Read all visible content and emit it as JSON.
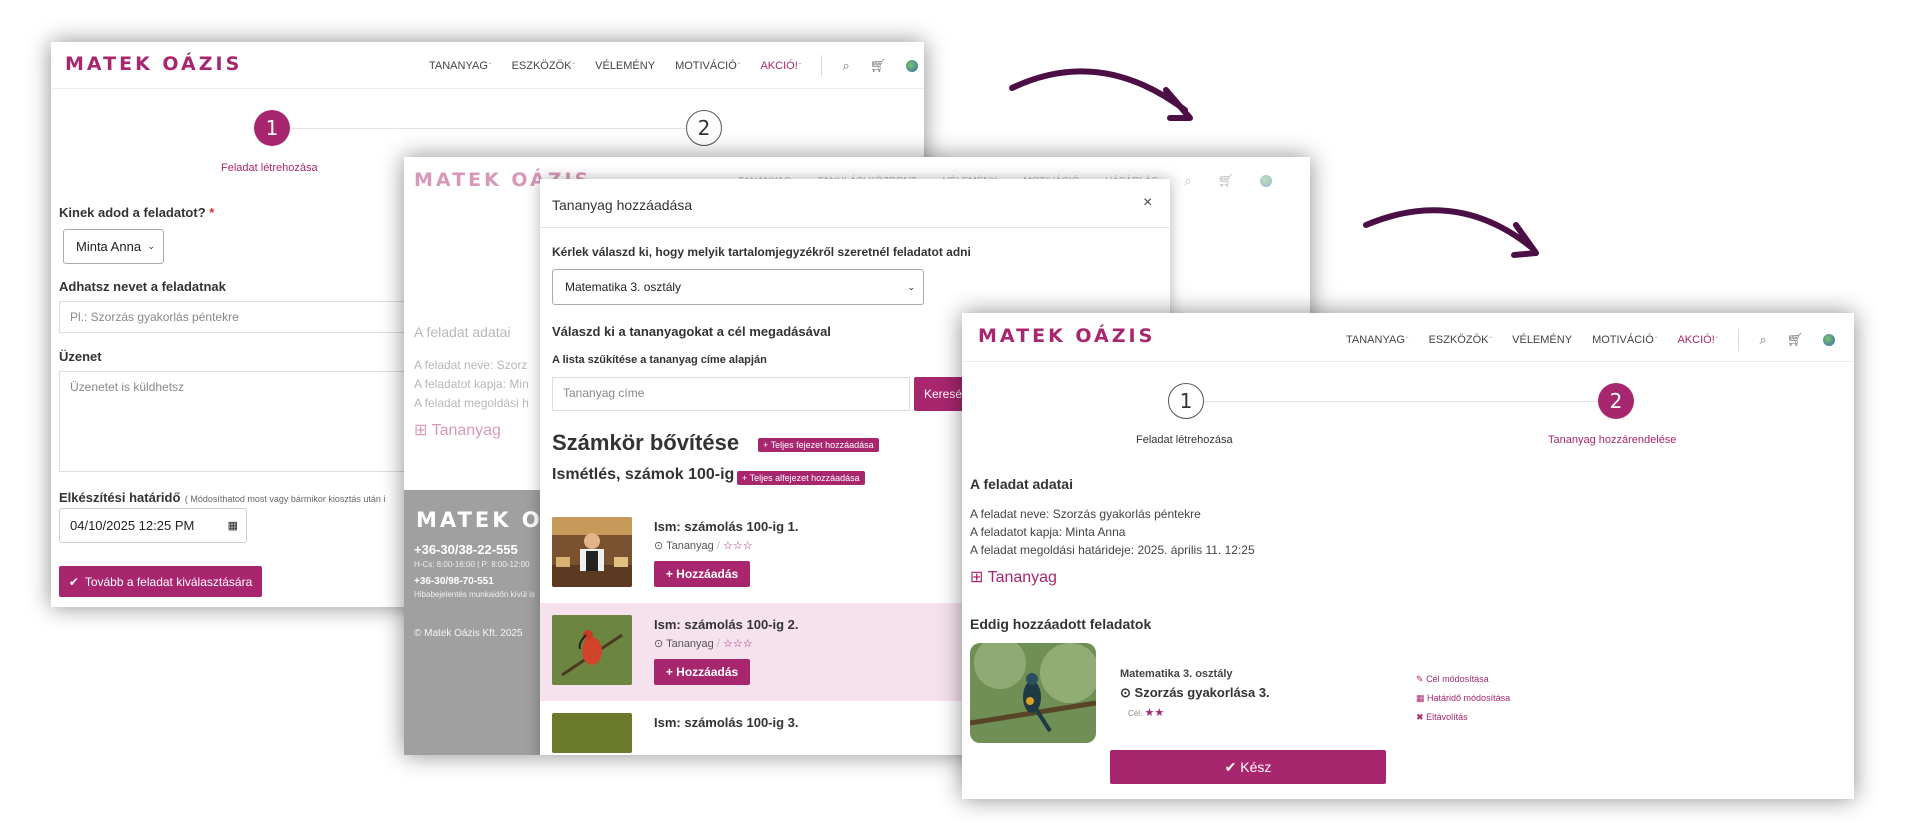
{
  "brand": {
    "logo": "MATEK OÁZIS",
    "accent": "#a8266e",
    "arrow_color": "#4b0f45"
  },
  "nav": {
    "tananyag": "TANANYAG",
    "eszkozok": "ESZKÖZÖK",
    "velemeny": "VÉLEMÉNY",
    "motivacio": "MOTIVÁCIÓ",
    "akcio": "AKCIÓ!",
    "tanulasi_kozpont": "TANULÁSI KÖZPONT",
    "vasarlas": "VÁSÁRLÁS"
  },
  "icons": [
    "search-icon",
    "cart-icon",
    "globe-icon",
    "close-icon",
    "check-icon",
    "plus-icon",
    "clock-icon",
    "star-icon",
    "calendar-icon",
    "pencil-icon",
    "chevron-down-icon"
  ],
  "s1": {
    "step1_num": "1",
    "step1_label": "Feladat létrehozása",
    "step2_num": "2",
    "q_who": "Kinek adod a feladatot?",
    "required": "*",
    "who_value": "Minta Anna",
    "q_name": "Adhatsz nevet a feladatnak",
    "name_placeholder": "Pl.: Szorzás gyakorlás péntekre",
    "q_message": "Üzenet",
    "message_placeholder": "Üzenetet is küldhetsz",
    "q_deadline": "Elkészítési határidő",
    "deadline_hint": "( Módosíthatod most vagy bármikor kiosztás után i",
    "deadline_value": "04/10/2025 12:25 PM",
    "next_button": "Tovább a feladat kiválasztására"
  },
  "s2": {
    "bg_title": "A feladat adatai",
    "bg_line1": "A feladat neve: Szorz",
    "bg_line2": "A feladatot kapja: Min",
    "bg_line3": "A feladat megoldási h",
    "bg_tananyag": "Tananyag",
    "footer_phone1": "+36-30/38-22-555",
    "footer_hours": "H-Cs: 8:00-16:00 | P: 8:00-12:00",
    "footer_phone2": "+36-30/98-70-551",
    "footer_note": "Hibabejelentés munkaidőn kívül is",
    "footer_copy": "© Matek Oázis Kft. 2025",
    "modal": {
      "title": "Tananyag hozzáadása",
      "choose_toc": "Kérlek válaszd ki, hogy melyik tartalomjegyzékről szeretnél feladatot adni",
      "toc_value": "Matematika 3. osztály",
      "choose_materials": "Válaszd ki a tananyagokat a cél megadásával",
      "filter_label": "A lista szűkítése a tananyag címe alapján",
      "filter_placeholder": "Tananyag címe",
      "search_button": "Keresé",
      "chapter": "Számkör bővítése",
      "chapter_add": "+ Teljes fejezet hozzáadása",
      "subchapter": "Ismétlés, számok 100-ig",
      "subchapter_add": "+ Teljes alfejezet hozzáadása",
      "items": [
        {
          "title": "Ism: számolás 100-ig 1.",
          "meta": "Tananyag",
          "stars": "☆☆☆",
          "button": "+ Hozzáadás"
        },
        {
          "title": "Ism: számolás 100-ig 2.",
          "meta": "Tananyag",
          "stars": "☆☆☆",
          "button": "+ Hozzáadás"
        },
        {
          "title": "Ism: számolás 100-ig 3."
        }
      ]
    }
  },
  "s3": {
    "step1_num": "1",
    "step1_label": "Feladat létrehozása",
    "step2_num": "2",
    "step2_label": "Tananyag hozzárendelése",
    "details_title": "A feladat adatai",
    "detail1": "A feladat neve: Szorzás gyakorlás péntekre",
    "detail2": "A feladatot kapja: Minta Anna",
    "detail3": "A feladat megoldási határideje: 2025. április 11. 12:25",
    "tananyag": "Tananyag",
    "added_title": "Eddig hozzáadott feladatok",
    "task": {
      "course": "Matematika 3. osztály",
      "name": "Szorzás gyakorlása 3.",
      "goal_label": "Cél:",
      "goal_stars": "★★",
      "action_goal": "Cél módosítása",
      "action_deadline": "Határidő módosítása",
      "action_remove": "Eltávolítás"
    },
    "done_button": "Kész"
  }
}
